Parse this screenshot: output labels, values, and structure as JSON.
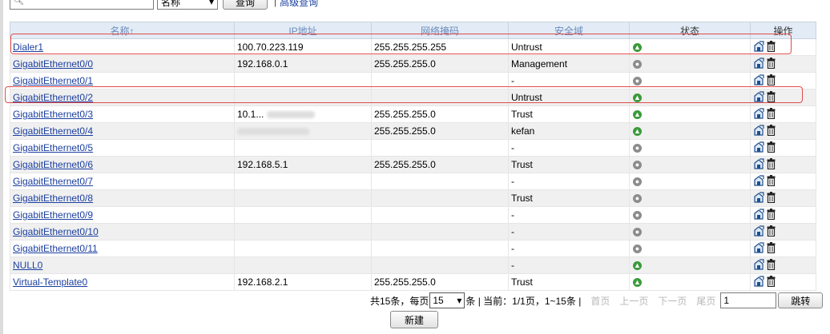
{
  "toolbar": {
    "search_placeholder": "",
    "field_select": "名称",
    "query_label": "查询",
    "separator": "|",
    "advanced_label": "高级查询"
  },
  "table": {
    "headers": [
      "名称↑",
      "IP地址",
      "网络掩码",
      "安全域",
      "状态",
      "操作"
    ],
    "rows": [
      {
        "name": "Dialer1",
        "ip": "100.70.223.119",
        "mask": "255.255.255.255",
        "zone": "Untrust",
        "status": "up"
      },
      {
        "name": "GigabitEthernet0/0",
        "ip": "192.168.0.1",
        "mask": "255.255.255.0",
        "zone": "Management",
        "status": "down"
      },
      {
        "name": "GigabitEthernet0/1",
        "ip": "",
        "mask": "",
        "zone": "-",
        "status": "down"
      },
      {
        "name": "GigabitEthernet0/2",
        "ip": "",
        "mask": "",
        "zone": "Untrust",
        "status": "up"
      },
      {
        "name": "GigabitEthernet0/3",
        "ip": "10.1...",
        "mask": "255.255.255.0",
        "zone": "Trust",
        "status": "up"
      },
      {
        "name": "GigabitEthernet0/4",
        "ip": "",
        "mask": "255.255.255.0",
        "zone": "kefan",
        "status": "up"
      },
      {
        "name": "GigabitEthernet0/5",
        "ip": "",
        "mask": "",
        "zone": "-",
        "status": "down"
      },
      {
        "name": "GigabitEthernet0/6",
        "ip": "192.168.5.1",
        "mask": "255.255.255.0",
        "zone": "Trust",
        "status": "down"
      },
      {
        "name": "GigabitEthernet0/7",
        "ip": "",
        "mask": "",
        "zone": "-",
        "status": "down"
      },
      {
        "name": "GigabitEthernet0/8",
        "ip": "",
        "mask": "",
        "zone": "Trust",
        "status": "down"
      },
      {
        "name": "GigabitEthernet0/9",
        "ip": "",
        "mask": "",
        "zone": "-",
        "status": "down"
      },
      {
        "name": "GigabitEthernet0/10",
        "ip": "",
        "mask": "",
        "zone": "-",
        "status": "down"
      },
      {
        "name": "GigabitEthernet0/11",
        "ip": "",
        "mask": "",
        "zone": "-",
        "status": "down"
      },
      {
        "name": "NULL0",
        "ip": "",
        "mask": "",
        "zone": "-",
        "status": "up"
      },
      {
        "name": "Virtual-Template0",
        "ip": "192.168.2.1",
        "mask": "255.255.255.0",
        "zone": "Trust",
        "status": "up"
      }
    ]
  },
  "pager": {
    "total_prefix": "共15条，每页",
    "page_size": "15",
    "summary": "条 | 当前：1/1页，1~15条 |",
    "first": "首页",
    "prev": "上一页",
    "next": "下一页",
    "last": "尾页",
    "page_input": "1",
    "jump_label": "跳转"
  },
  "actions": {
    "new_label": "新建"
  },
  "colors": {
    "status_up": "#3b9a3b",
    "status_down": "#8c8c8c",
    "highlight": "#e14a4a",
    "header_bg": "#e3ecf6",
    "link": "#1b3fa0"
  }
}
